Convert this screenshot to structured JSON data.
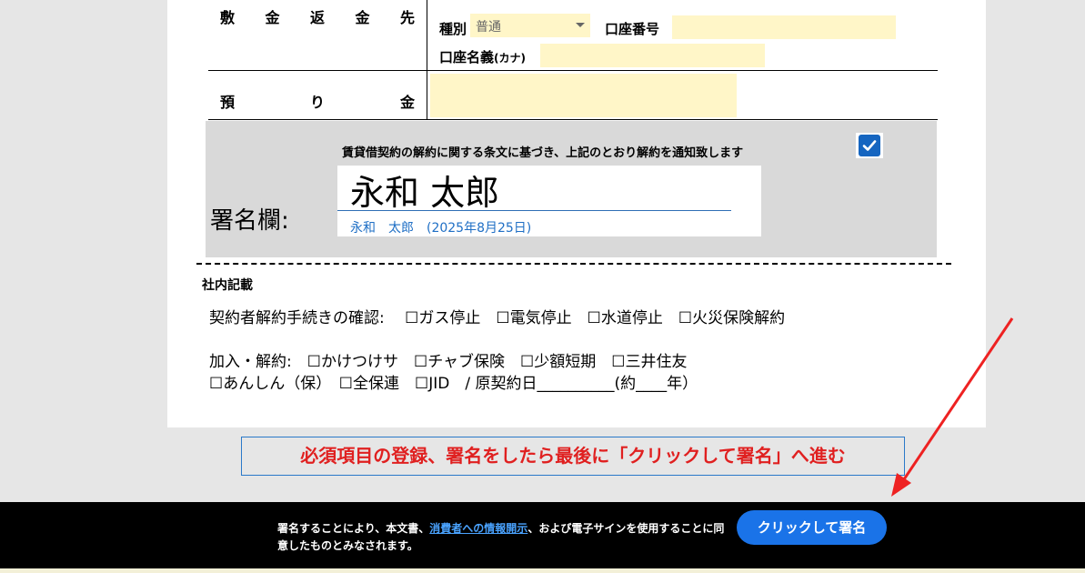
{
  "form": {
    "row1_label": "敷金返金先",
    "row2_label": "預り金",
    "account_type_label": "種別",
    "account_type_value": "普通",
    "account_number_label": "口座番号",
    "account_number_value": "",
    "account_name_label": "口座名義",
    "account_name_kana": "(カナ)",
    "account_name_value": "",
    "deposit_value": ""
  },
  "signature": {
    "agree_text": "賃貸借契約の解約に関する条文に基づき、上記のとおり解約を通知致します",
    "agree_checked": true,
    "label": "署名欄:",
    "name": "永和 太郎",
    "caption": "永和　太郎　(2025年8月25日)"
  },
  "internal": {
    "title": "社内記載",
    "line1": "契約者解約手続きの確認:　 ☐ガス停止　☐電気停止　☐水道停止　☐火災保険解約",
    "line2": "加入・解約:　☐かけつけサ　☐チャブ保険　☐少額短期　☐三井住友",
    "line3": "☐あんしん（保）　☐全保連　☐JID　/ 原契約日__________(約____年）"
  },
  "instruction": "必須項目の登録、署名をしたら最後に「クリックして署名」へ進む",
  "footer": {
    "text_before": "署名することにより、本文書、",
    "link": "消費者への情報開示",
    "text_after": "、および電子サインを使用することに同意したものとみなされます。",
    "button": "クリックして署名"
  },
  "colors": {
    "field_yellow": "#fff6c8",
    "accent_blue": "#1a73e8",
    "instruction_red": "#e02020",
    "footer_bg": "#000000"
  }
}
